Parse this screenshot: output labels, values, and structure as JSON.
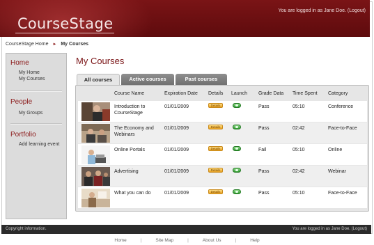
{
  "header": {
    "logo_left": "Course",
    "logo_right": "Stage",
    "user_status": "You are logged in as Jane Doe. (Logout)"
  },
  "breadcrumb": {
    "home": "CourseStage Home",
    "current": "My Courses"
  },
  "sidebar": {
    "sections": [
      {
        "title": "Home",
        "items": [
          "My Home",
          "My Courses"
        ]
      },
      {
        "title": "People",
        "items": [
          "My Groups"
        ]
      },
      {
        "title": "Portfolio",
        "items": [
          "Add learning event"
        ]
      }
    ]
  },
  "main": {
    "title": "My Courses",
    "tabs": [
      "All courses",
      "Active courses",
      "Past courses"
    ],
    "columns": [
      "Course Name",
      "Expiration Date",
      "Details",
      "Launch",
      "Grade Data",
      "Time Spent",
      "Category"
    ],
    "details_label": "Details",
    "rows": [
      {
        "name": "Introduction to CourseStage",
        "expiration": "01/01/2009",
        "grade": "Pass",
        "time": "05:10",
        "category": "Conference"
      },
      {
        "name": "The Economy and Webinars",
        "expiration": "01/01/2009",
        "grade": "Pass",
        "time": "02:42",
        "category": "Face-to-Face"
      },
      {
        "name": "Online Portals",
        "expiration": "01/01/2009",
        "grade": "Fail",
        "time": "05:10",
        "category": "Online"
      },
      {
        "name": "Advertising",
        "expiration": "01/01/2009",
        "grade": "Pass",
        "time": "02:42",
        "category": "Webinar"
      },
      {
        "name": "What you can do",
        "expiration": "01/01/2009",
        "grade": "Pass",
        "time": "05:10",
        "category": "Face-to-Face"
      }
    ]
  },
  "footer": {
    "copyright": "Copyright information.",
    "user_status": "You are logged in as Jane Doe. (Logout)",
    "links": [
      "Home",
      "Site Map",
      "About Us",
      "Help"
    ]
  },
  "colors": {
    "brand": "#7a1416",
    "accent_text": "#8b1a1a",
    "footer_bg": "#2b2b2b"
  }
}
